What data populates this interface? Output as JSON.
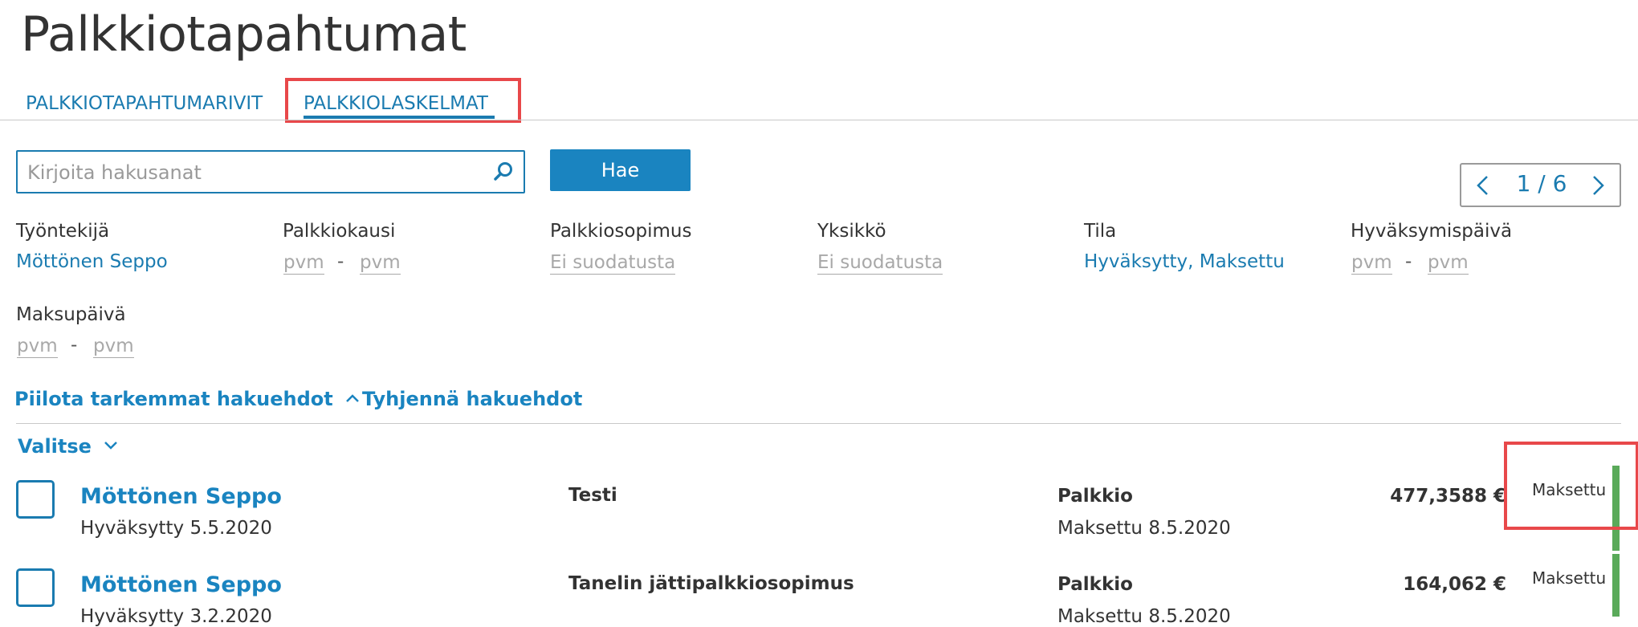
{
  "page": {
    "title": "Palkkiotapahtumat"
  },
  "tabs": [
    {
      "label": "PALKKIOTAPAHTUMARIVIT",
      "active": false
    },
    {
      "label": "PALKKIOLASKELMAT",
      "active": true
    }
  ],
  "search": {
    "placeholder": "Kirjoita hakusanat",
    "value": "",
    "button_label": "Hae"
  },
  "pager": {
    "text": "1 / 6"
  },
  "filters": {
    "employee": {
      "label": "Työntekijä",
      "value": "Möttönen Seppo"
    },
    "period": {
      "label": "Palkkiokausi",
      "from": "pvm",
      "to": "pvm",
      "separator": "-"
    },
    "agreement": {
      "label": "Palkkiosopimus",
      "value": "Ei suodatusta"
    },
    "unit": {
      "label": "Yksikkö",
      "value": "Ei suodatusta"
    },
    "status": {
      "label": "Tila",
      "value": "Hyväksytty, Maksettu"
    },
    "approval_date": {
      "label": "Hyväksymispäivä",
      "from": "pvm",
      "to": "pvm",
      "separator": "-"
    },
    "payment_date": {
      "label": "Maksupäivä",
      "from": "pvm",
      "to": "pvm",
      "separator": "-"
    }
  },
  "actions": {
    "hide_filters": "Piilota tarkemmat hakuehdot",
    "clear_filters": "Tyhjennä hakuehdot",
    "select": "Valitse"
  },
  "rows": [
    {
      "name": "Möttönen Seppo",
      "approved": "Hyväksytty 5.5.2020",
      "agreement": "Testi",
      "type": "Palkkio",
      "paid": "Maksettu 8.5.2020",
      "amount": "477,3588 €",
      "status": "Maksettu"
    },
    {
      "name": "Möttönen Seppo",
      "approved": "Hyväksytty 3.2.2020",
      "agreement": "Tanelin jättipalkkiosopimus",
      "type": "Palkkio",
      "paid": "Maksettu 8.5.2020",
      "amount": "164,062 €",
      "status": "Maksettu"
    }
  ],
  "colors": {
    "accent": "#1a84c0",
    "highlight": "#e8484a",
    "status_paid": "#5aaa5a"
  },
  "icons": {
    "search": "search-icon",
    "prev": "chevron-left-icon",
    "next": "chevron-right-icon",
    "collapse": "chevron-up-icon",
    "dropdown": "chevron-down-icon"
  }
}
